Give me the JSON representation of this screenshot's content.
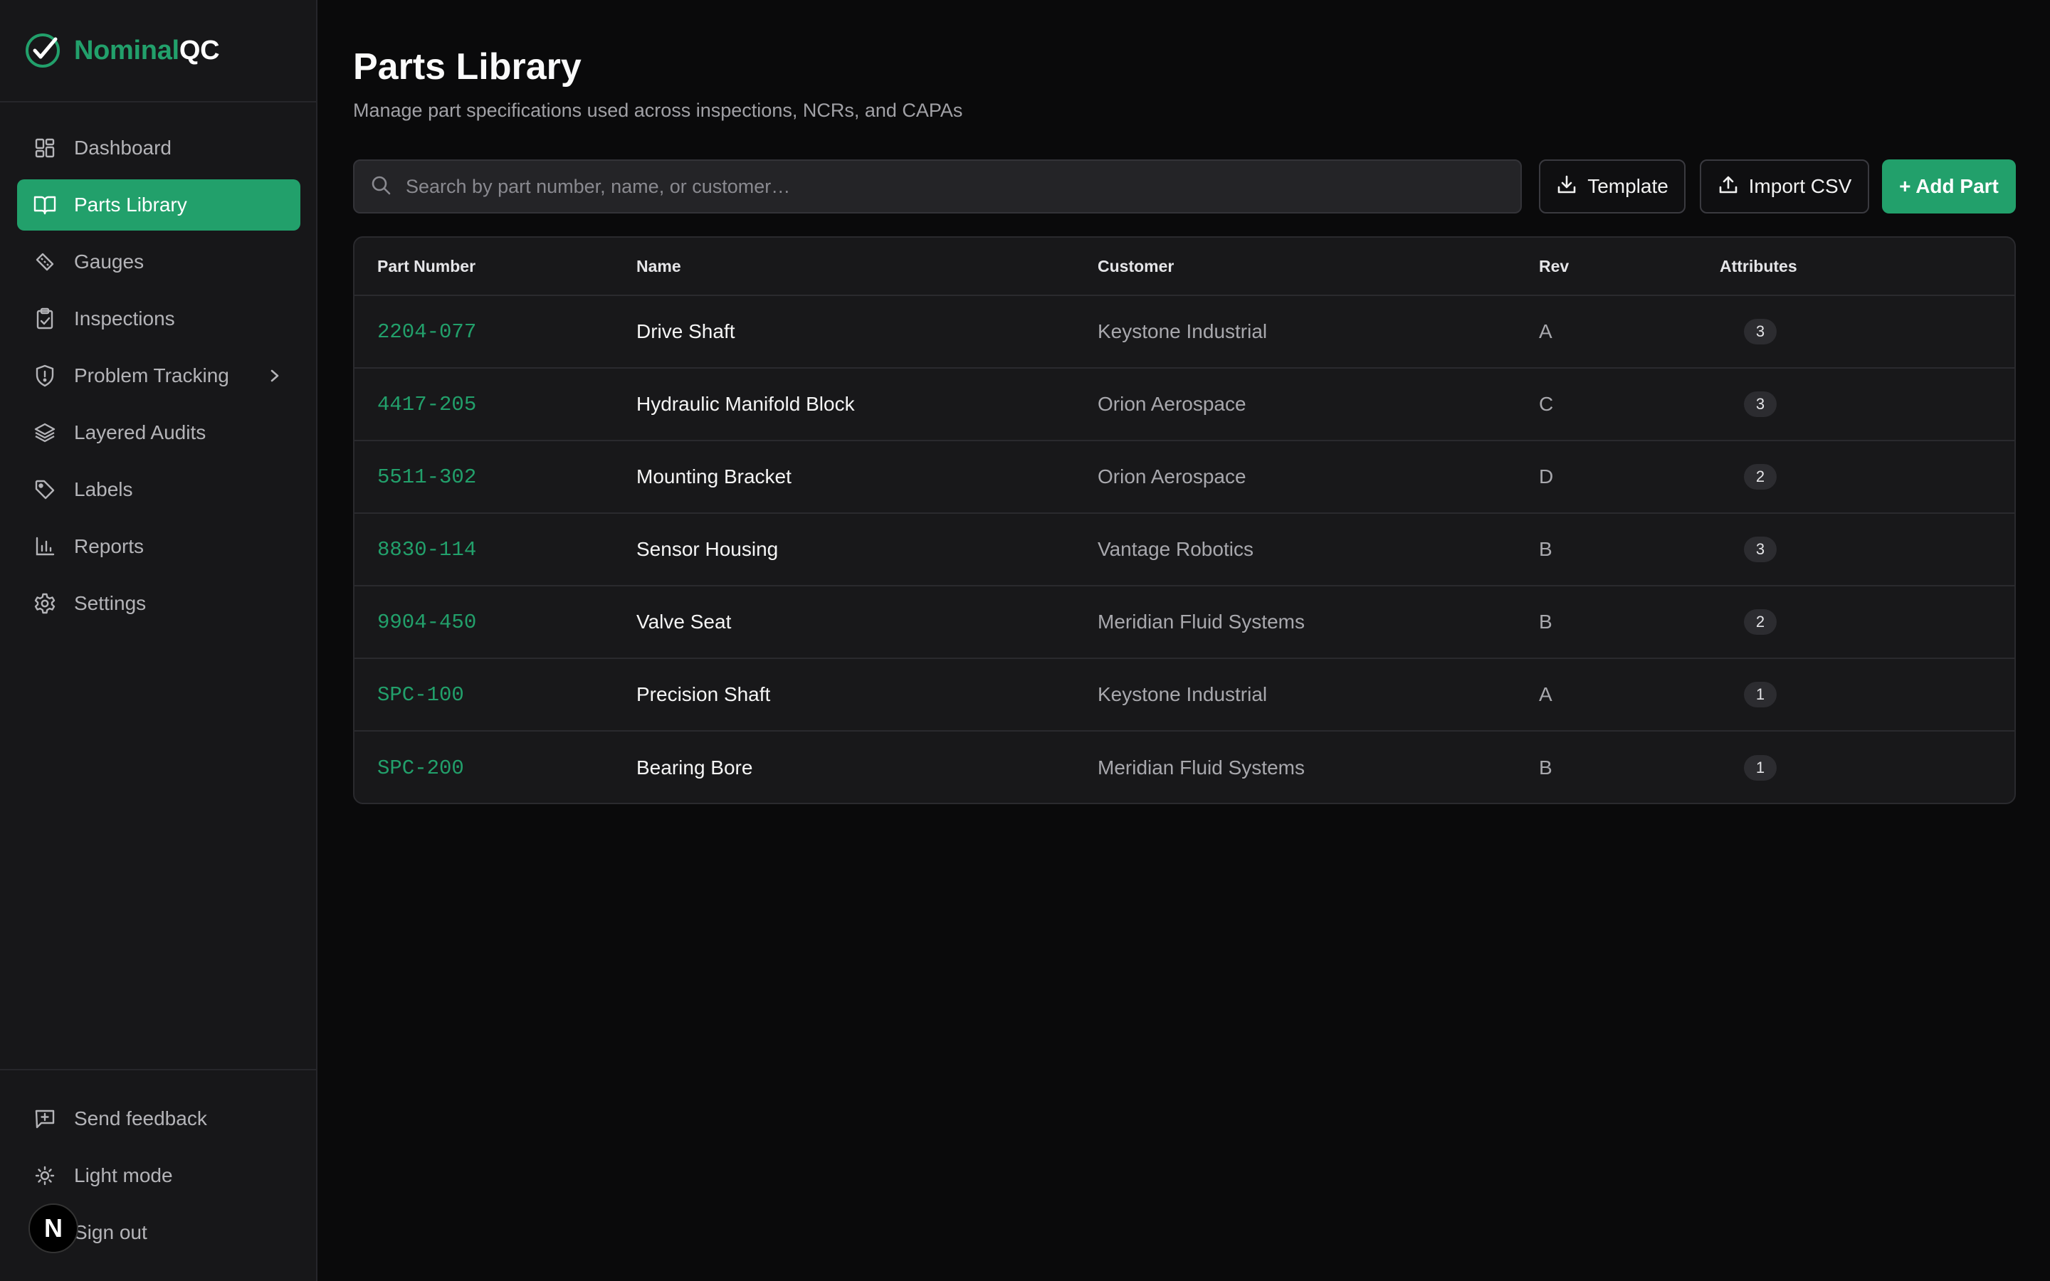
{
  "brand": {
    "name_accent": "Nominal",
    "name_rest": "QC"
  },
  "sidebar": {
    "items": [
      {
        "label": "Dashboard",
        "icon": "dashboard-icon",
        "active": false
      },
      {
        "label": "Parts Library",
        "icon": "book-icon",
        "active": true
      },
      {
        "label": "Gauges",
        "icon": "ruler-icon",
        "active": false
      },
      {
        "label": "Inspections",
        "icon": "clipboard-check-icon",
        "active": false
      },
      {
        "label": "Problem Tracking",
        "icon": "shield-alert-icon",
        "active": false,
        "has_submenu": true
      },
      {
        "label": "Layered Audits",
        "icon": "layers-icon",
        "active": false
      },
      {
        "label": "Labels",
        "icon": "tag-icon",
        "active": false
      },
      {
        "label": "Reports",
        "icon": "bar-chart-icon",
        "active": false
      },
      {
        "label": "Settings",
        "icon": "gear-icon",
        "active": false
      }
    ],
    "bottom": [
      {
        "label": "Send feedback",
        "icon": "message-plus-icon"
      },
      {
        "label": "Light mode",
        "icon": "sun-icon"
      },
      {
        "label": "Sign out",
        "icon": "sign-out-icon"
      }
    ]
  },
  "avatar": {
    "letter": "N"
  },
  "page": {
    "title": "Parts Library",
    "subtitle": "Manage part specifications used across inspections, NCRs, and CAPAs"
  },
  "search": {
    "placeholder": "Search by part number, name, or customer…",
    "value": ""
  },
  "toolbar": {
    "template_label": "Template",
    "import_label": "Import CSV",
    "add_label": "+ Add Part"
  },
  "table": {
    "columns": [
      "Part Number",
      "Name",
      "Customer",
      "Rev",
      "Attributes"
    ],
    "rows": [
      {
        "part_number": "2204-077",
        "name": "Drive Shaft",
        "customer": "Keystone Industrial",
        "rev": "A",
        "attributes": "3"
      },
      {
        "part_number": "4417-205",
        "name": "Hydraulic Manifold Block",
        "customer": "Orion Aerospace",
        "rev": "C",
        "attributes": "3"
      },
      {
        "part_number": "5511-302",
        "name": "Mounting Bracket",
        "customer": "Orion Aerospace",
        "rev": "D",
        "attributes": "2"
      },
      {
        "part_number": "8830-114",
        "name": "Sensor Housing",
        "customer": "Vantage Robotics",
        "rev": "B",
        "attributes": "3"
      },
      {
        "part_number": "9904-450",
        "name": "Valve Seat",
        "customer": "Meridian Fluid Systems",
        "rev": "B",
        "attributes": "2"
      },
      {
        "part_number": "SPC-100",
        "name": "Precision Shaft",
        "customer": "Keystone Industrial",
        "rev": "A",
        "attributes": "1"
      },
      {
        "part_number": "SPC-200",
        "name": "Bearing Bore",
        "customer": "Meridian Fluid Systems",
        "rev": "B",
        "attributes": "1"
      }
    ]
  },
  "colors": {
    "accent": "#22a06b",
    "background": "#0a0a0b",
    "sidebar": "#171719",
    "card": "#18181a"
  }
}
